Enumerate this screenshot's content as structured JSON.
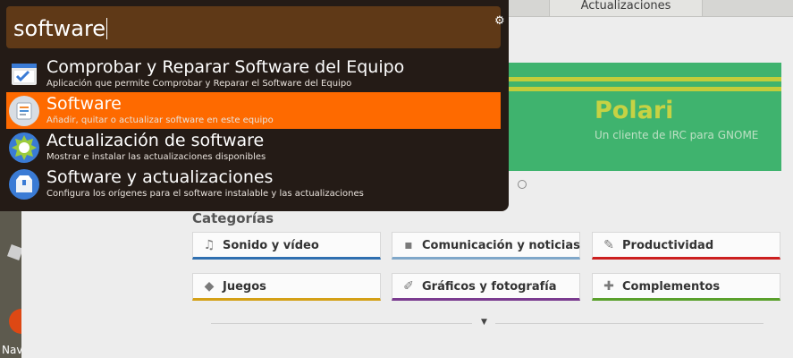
{
  "desktop": {
    "launcher_label": "Nav"
  },
  "app": {
    "tabs": [
      {
        "label": ""
      },
      {
        "label": "Actualizaciones"
      }
    ],
    "banner": {
      "title": "Polari",
      "subtitle": "Un cliente de IRC para GNOME"
    },
    "categories_heading": "Categorías",
    "categories": [
      {
        "label": "Sonido y vídeo",
        "icon": "music-note-icon",
        "color": "#2f6fb0"
      },
      {
        "label": "Comunicación y noticias",
        "icon": "chat-bubble-icon",
        "color": "#7fa7c9"
      },
      {
        "label": "Productividad",
        "icon": "edit-document-icon",
        "color": "#cc1f1f"
      },
      {
        "label": "Juegos",
        "icon": "gamepad-icon",
        "color": "#d4a017"
      },
      {
        "label": "Gráficos y fotografía",
        "icon": "brush-icon",
        "color": "#7a3b8f"
      },
      {
        "label": "Complementos",
        "icon": "puzzle-icon",
        "color": "#5aa02c"
      }
    ]
  },
  "dash": {
    "search_value": "software",
    "results": [
      {
        "title": "Comprobar y Reparar Software del Equipo",
        "description": "Aplicación que permite Comprobar y Reparar el Software del Equipo",
        "icon": "window-check-icon",
        "selected": false
      },
      {
        "title": "Software",
        "description": "Añadir, quitar o actualizar software en este equipo",
        "icon": "software-center-icon",
        "selected": true
      },
      {
        "title": "Actualización de software",
        "description": "Mostrar e instalar las actualizaciones disponibles",
        "icon": "update-badge-icon",
        "selected": false
      },
      {
        "title": "Software y actualizaciones",
        "description": "Configura los orígenes para el software instalable y las actualizaciones",
        "icon": "package-box-icon",
        "selected": false
      }
    ]
  },
  "colors": {
    "accent": "#fe6a00",
    "search_bg": "#5f3917",
    "dash_bg": "#241b16",
    "banner_bg": "#3fb36e"
  }
}
